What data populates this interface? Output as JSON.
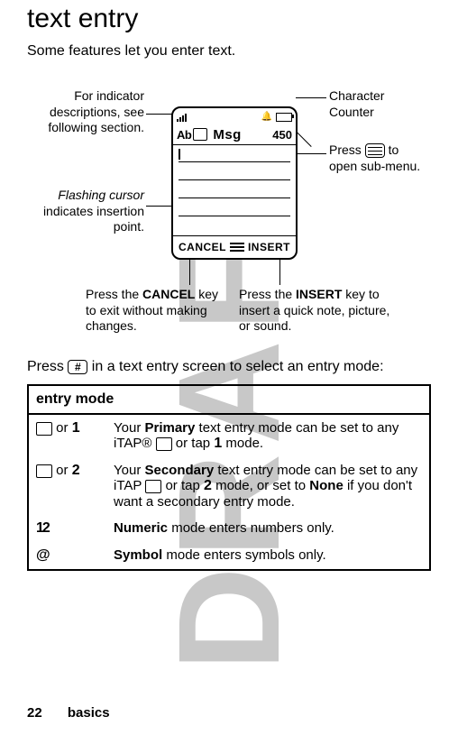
{
  "title": "text entry",
  "intro": "Some features let you enter text.",
  "callouts": {
    "indicator": "For indicator descriptions, see following section.",
    "cursor_line1": "Flashing cursor",
    "cursor_line2": "indicates insertion point.",
    "cancel_line1": "Press the ",
    "cancel_label": "CANCEL",
    "cancel_line2": " key to exit without making changes.",
    "counter": "Character Counter",
    "submenu_line1": "Press ",
    "submenu_line2": " to open sub-menu.",
    "insert_line1": "Press the ",
    "insert_label": "INSERT",
    "insert_line2": " key to insert a quick note, picture, or sound."
  },
  "phone": {
    "mode_indicator": "Ab",
    "title": "Msg",
    "counter": "450",
    "left_soft": "CANCEL",
    "right_soft": "INSERT"
  },
  "under_diagram_pre": "Press ",
  "under_diagram_key": "#",
  "under_diagram_post": " in a text entry screen to select an entry mode:",
  "table": {
    "header": "entry mode",
    "rows": [
      {
        "icon_alt": "1",
        "or": " or ",
        "desc_pre": "Your ",
        "desc_bold": "Primary",
        "desc_mid": " text entry mode can be set to any iTAP® ",
        "tap_or": " or tap ",
        "tap_alt": "1",
        "desc_post": " mode."
      },
      {
        "icon_alt": "2",
        "or": " or ",
        "desc_pre": "Your ",
        "desc_bold": "Secondary",
        "desc_mid": " text entry mode can be set to any iTAP ",
        "tap_or": " or tap ",
        "tap_alt": "2",
        "desc_post_a": " mode, or set to ",
        "desc_none": "None",
        "desc_post_b": " if you don't want a secondary entry mode."
      },
      {
        "icon_alt": "12",
        "desc_bold": "Numeric",
        "desc_post": " mode enters numbers only."
      },
      {
        "icon_alt": "@",
        "desc_bold": "Symbol",
        "desc_post": " mode enters symbols only."
      }
    ]
  },
  "footer": {
    "page": "22",
    "section": "basics"
  },
  "watermark": "DRAFT"
}
